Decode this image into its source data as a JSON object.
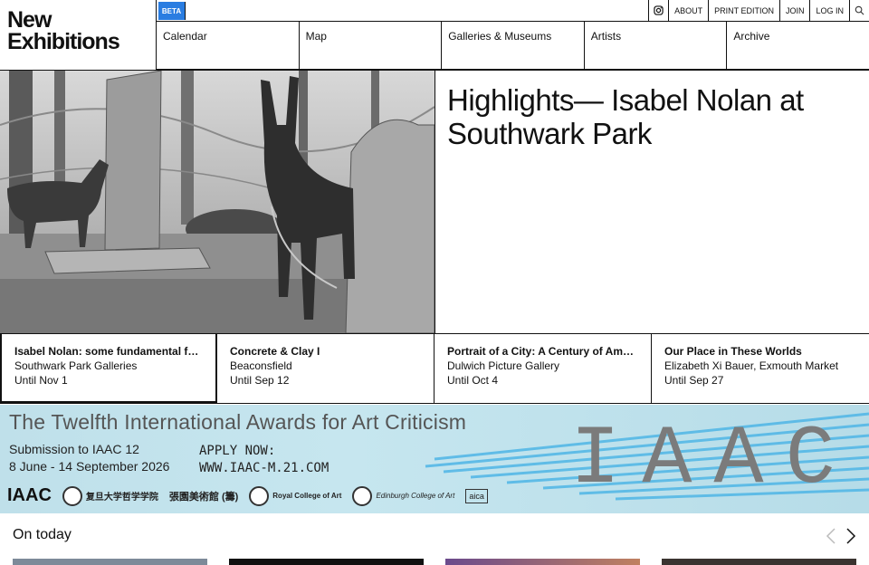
{
  "logo": {
    "line1": "New",
    "line2": "Exhibitions"
  },
  "top_bar": {
    "beta": "BETA",
    "links": [
      {
        "label": "ABOUT"
      },
      {
        "label": "PRINT EDITION"
      },
      {
        "label": "JOIN"
      },
      {
        "label": "LOG IN"
      }
    ],
    "icons": {
      "instagram": "instagram-icon",
      "search": "search-icon"
    }
  },
  "nav": [
    "Calendar",
    "Map",
    "Galleries & Museums",
    "Artists",
    "Archive"
  ],
  "hero": {
    "title": "Highlights— Isabel Nolan at Southwark Park"
  },
  "cards": [
    {
      "title": "Isabel Nolan: some fundamental forces",
      "venue": "Southwark Park Galleries",
      "until": "Until Nov 1"
    },
    {
      "title": "Concrete & Clay I",
      "venue": "Beaconsfield",
      "until": "Until Sep 12"
    },
    {
      "title": "Portrait of a City: A Century of Americ...",
      "venue": "Dulwich Picture Gallery",
      "until": "Until Oct 4"
    },
    {
      "title": "Our Place in These Worlds",
      "venue": "Elizabeth Xi Bauer, Exmouth Market",
      "until": "Until Sep 27"
    }
  ],
  "ad": {
    "headline": "The Twelfth International Awards for Art Criticism",
    "submission": "Submission to IAAC 12",
    "dates": "8 June - 14 September 2026",
    "apply": "APPLY NOW:",
    "url": "WWW.IAAC-M.21.COM",
    "big": "IAAC",
    "logos": {
      "iaac": "IAAC",
      "fudan": "复旦大学哲学学院",
      "zhangyuan": "張園美術館 (籌)",
      "rca": "Royal College of Art",
      "edinburgh": "Edinburgh College of Art",
      "aica": "aica"
    }
  },
  "on_today": {
    "label": "On today"
  },
  "colors": {
    "beta_bg": "#2a7de1",
    "ad_bg": "#c6e6ef",
    "line": "#111111"
  }
}
